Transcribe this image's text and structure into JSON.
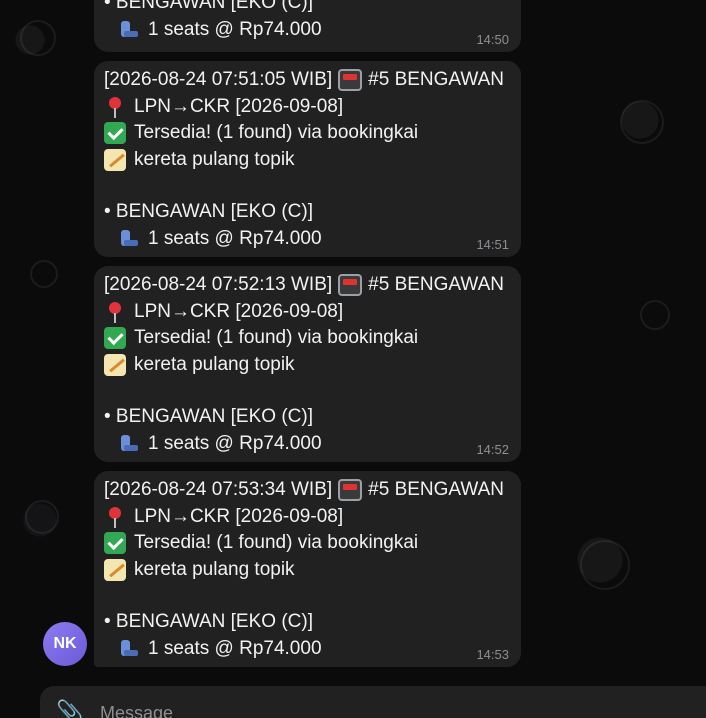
{
  "messages": [
    {
      "lines": [
        "• BENGAWAN [EKO (C)]"
      ],
      "seat_line": "1 seats @ Rp74.000",
      "time": "14:50"
    },
    {
      "header": "[2026-08-24 07:51:05 WIB]",
      "train_name": "#5 BENGAWAN",
      "route": "LPN→CKR [2026-09-08]",
      "status": "Tersedia! (1 found) via bookingkai",
      "note": "kereta pulang topik",
      "train_line": "• BENGAWAN [EKO (C)]",
      "seat_line": "1 seats @ Rp74.000",
      "time": "14:51"
    },
    {
      "header": "[2026-08-24 07:52:13 WIB]",
      "train_name": "#5 BENGAWAN",
      "route": "LPN→CKR [2026-09-08]",
      "status": "Tersedia! (1 found) via bookingkai",
      "note": "kereta pulang topik",
      "train_line": "• BENGAWAN [EKO (C)]",
      "seat_line": "1 seats @ Rp74.000",
      "time": "14:52"
    },
    {
      "header": "[2026-08-24 07:53:34 WIB]",
      "train_name": "#5 BENGAWAN",
      "route": "LPN→CKR [2026-09-08]",
      "status": "Tersedia! (1 found) via bookingkai",
      "note": "kereta pulang topik",
      "train_line": "• BENGAWAN [EKO (C)]",
      "seat_line": "1 seats @ Rp74.000",
      "time": "14:53"
    }
  ],
  "avatar": {
    "initials": "NK",
    "color": "#7b68e6"
  },
  "composer": {
    "placeholder": "Message"
  },
  "icons": {
    "pin": "round-pushpin-icon",
    "check": "check-mark-button-icon",
    "memo": "memo-icon",
    "train": "train-icon",
    "seat": "seat-icon",
    "attach": "paperclip-icon"
  },
  "colors": {
    "background": "#0b0b0c",
    "bubble": "#212121",
    "timestamp": "#8e8e93"
  }
}
